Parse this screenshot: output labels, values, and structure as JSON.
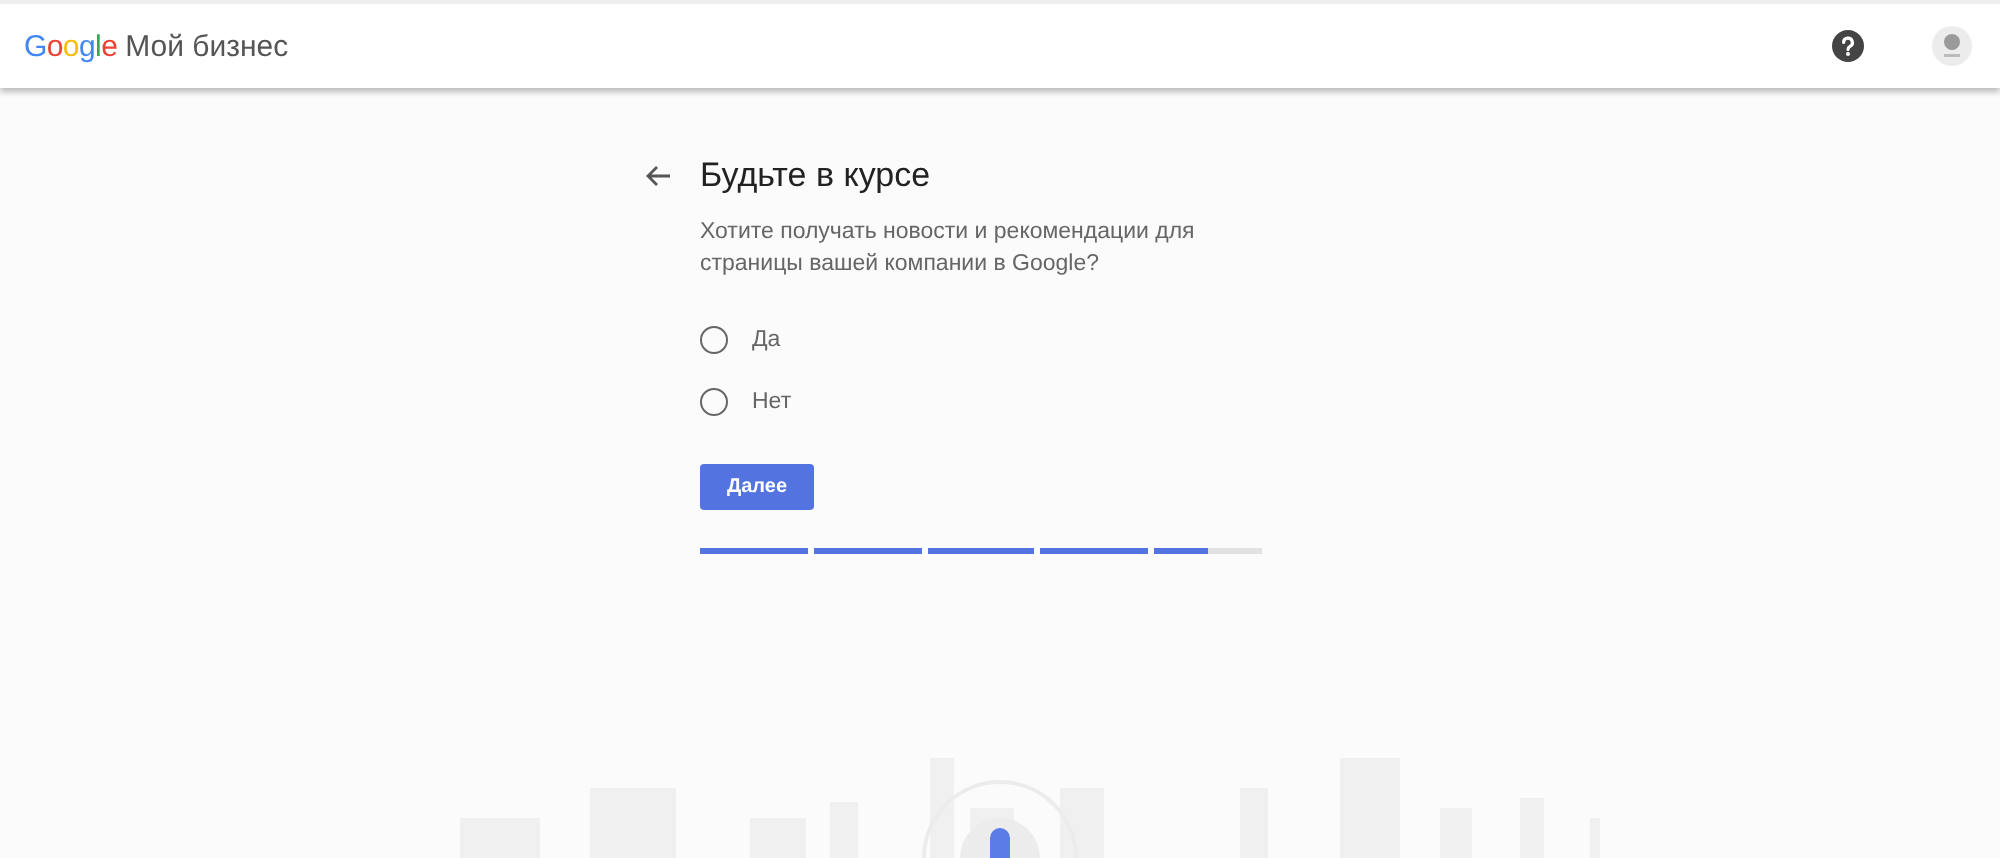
{
  "header": {
    "logo": "Google",
    "product": "Мой бизнес"
  },
  "step": {
    "title": "Будьте в курсе",
    "question": "Хотите получать новости и рекомендации для страницы вашей компании в Google?",
    "options": [
      {
        "label": "Да",
        "selected": false
      },
      {
        "label": "Нет",
        "selected": false
      }
    ],
    "button": "Далее",
    "progress": [
      {
        "level": 1
      },
      {
        "level": 1
      },
      {
        "level": 1
      },
      {
        "level": 1
      },
      {
        "level": 0.5
      }
    ]
  }
}
